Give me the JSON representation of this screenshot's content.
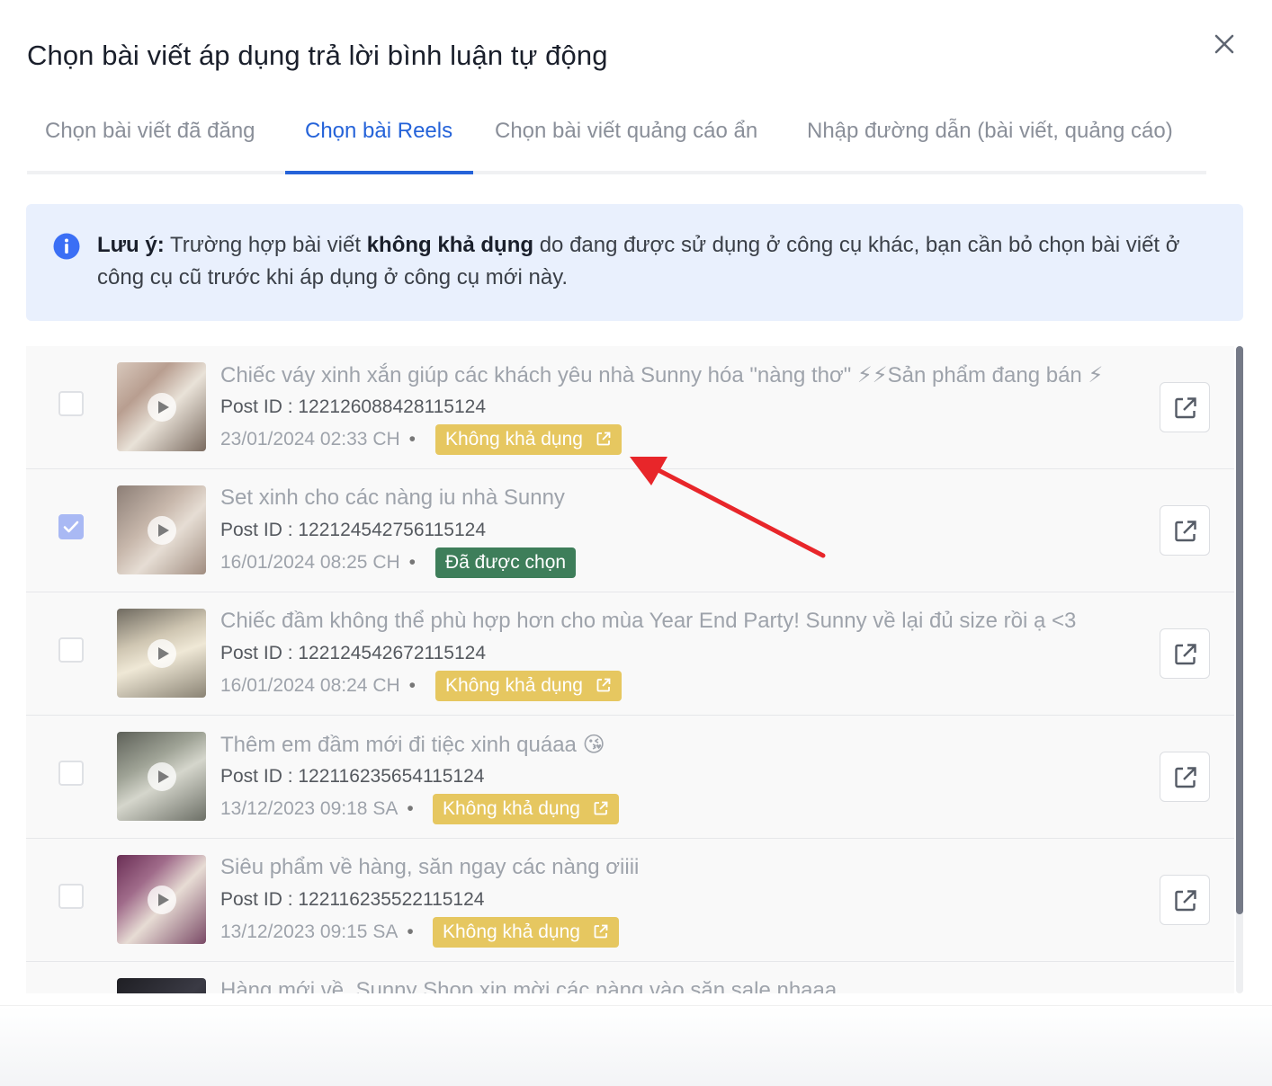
{
  "dialog": {
    "title": "Chọn bài viết áp dụng trả lời bình luận tự động",
    "close_icon": "close-icon"
  },
  "tabs": [
    {
      "label": "Chọn bài viết đã đăng",
      "active": false
    },
    {
      "label": "Chọn bài Reels",
      "active": true
    },
    {
      "label": "Chọn bài viết quảng cáo ẩn",
      "active": false
    },
    {
      "label": "Nhập đường dẫn (bài viết, quảng cáo)",
      "active": false
    }
  ],
  "notice": {
    "icon": "info-icon",
    "prefix": "Lưu ý:",
    "text1": " Trường hợp bài viết ",
    "bold": "không khả dụng",
    "text2": " do đang được sử dụng ở công cụ khác, bạn cần bỏ chọn bài viết ở công cụ cũ trước khi áp dụng ở công cụ mới này."
  },
  "posts": [
    {
      "title": "Chiếc váy xinh xắn giúp các khách yêu nhà Sunny hóa \"nàng thơ\" ⚡⚡Sản phẩm đang bán ⚡",
      "post_id": "Post ID : 122126088428115124",
      "date": "23/01/2024 02:33 CH",
      "dot": "•",
      "status": "Không khả dụng",
      "checked": false
    },
    {
      "title": "Set xinh cho các nàng iu nhà Sunny",
      "post_id": "Post ID : 122124542756115124",
      "date": "16/01/2024 08:25 CH",
      "dot": "•",
      "status": "Đã được chọn",
      "checked": true
    },
    {
      "title": "Chiếc đầm không thể phù hợp hơn cho mùa Year End Party! Sunny về lại đủ size rồi ạ <3",
      "post_id": "Post ID : 122124542672115124",
      "date": "16/01/2024 08:24 CH",
      "dot": "•",
      "status": "Không khả dụng",
      "checked": false
    },
    {
      "title": "Thêm em đầm mới đi tiệc xinh quáaa 😘",
      "post_id": "Post ID : 122116235654115124",
      "date": "13/12/2023 09:18 SA",
      "dot": "•",
      "status": "Không khả dụng",
      "checked": false
    },
    {
      "title": "Siêu phẩm về hàng, săn ngay các nàng ơiiii",
      "post_id": "Post ID : 122116235522115124",
      "date": "13/12/2023 09:15 SA",
      "dot": "•",
      "status": "Không khả dụng",
      "checked": false
    },
    {
      "title": "Hàng mới về, Sunny Shop xin mời các nàng vào săn sale nhaaa",
      "post_id": "",
      "date": "",
      "dot": "",
      "status": "",
      "checked": false
    }
  ],
  "colors": {
    "accent": "#2563d9",
    "unavailable_badge": "#e6c760",
    "chosen_badge": "#3e7e5a",
    "notice_bg": "#e9f0fd",
    "annotation_arrow": "#e8262a"
  },
  "icons": {
    "thumbnail_overlay": "play-icon",
    "badge_icon": "external-link-icon",
    "row_action": "open-external-icon",
    "annotation": "red-arrow-icon"
  }
}
